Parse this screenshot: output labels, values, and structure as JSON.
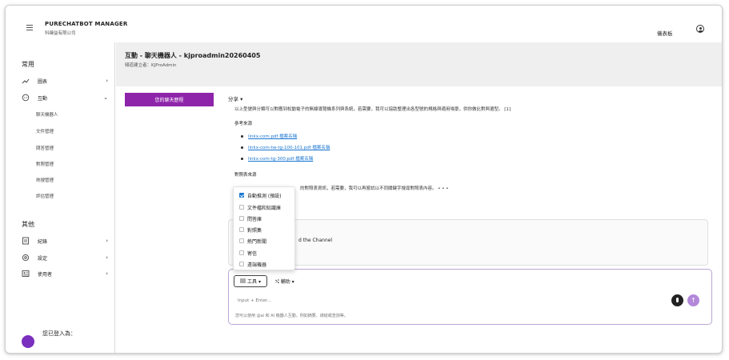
{
  "app": {
    "title": "PURECHATBOT MANAGER",
    "subtitle": "科臻益有限公司",
    "dashboard_label": "儀表板"
  },
  "sidebar": {
    "common_title": "常用",
    "other_title": "其他",
    "items": [
      {
        "label": "圖表",
        "icon": "chart-icon"
      },
      {
        "label": "互動",
        "icon": "chat-icon",
        "expanded": true
      }
    ],
    "sub_items": [
      "聊天機器人",
      "文件管理",
      "問答管理",
      "對照管理",
      "熱搜管理",
      "評估管理"
    ],
    "other_items": [
      {
        "label": "紀錄",
        "icon": "log-icon"
      },
      {
        "label": "設定",
        "icon": "settings-icon"
      },
      {
        "label": "使用者",
        "icon": "users-icon"
      }
    ],
    "logged_in_label": "您已登入為："
  },
  "page": {
    "title": "互動 - 聊天機器人 - kjproadmin20260405",
    "subtitle": "頻道建立者：KJProAdmin",
    "history_button": "您的聊天歷程"
  },
  "message": {
    "share_label": "分享 ▾",
    "body": "以上型號與分類可以對應到松動電子的無線導覽機系列與系統，若需要，我可以協助整理出各型號的規格與適用場景，供你做比對與選型。 [1]",
    "ref_title": "參考來源",
    "refs": [
      "linkx-com.pdf 檔案名稱",
      "linkx-com-tw-tg-100-101.pdf 檔案名稱",
      "linkx-com-tg-300.pdf 檔案名稱"
    ],
    "compare_title": "對照表來源",
    "compare_text": "的對照表資訊，若需要，我可以再嘗試以不同關鍵字搜尋對照表內容。 • • •"
  },
  "card": {
    "text": "d the Channel"
  },
  "chat": {
    "tools_label": "工具 ▾",
    "assist_label": "⤭ 輔助 ▾",
    "input_placeholder": "Input + Enter...",
    "hint": "您可以使用 @ai 和 AI 機器人互動，例如摘要、總結或查詢等。"
  },
  "dropdown": {
    "items": [
      {
        "label": "自動推測 (預設)",
        "checked": true
      },
      {
        "label": "文件檔和知識庫",
        "checked": false
      },
      {
        "label": "問答庫",
        "checked": false
      },
      {
        "label": "對照集",
        "checked": false
      },
      {
        "label": "熱門新聞",
        "checked": false
      },
      {
        "label": "寄信",
        "checked": false
      },
      {
        "label": "遠端機器",
        "checked": false
      }
    ]
  },
  "colors": {
    "accent": "#8e24aa",
    "link": "#1976d2",
    "send": "#b388d9"
  }
}
